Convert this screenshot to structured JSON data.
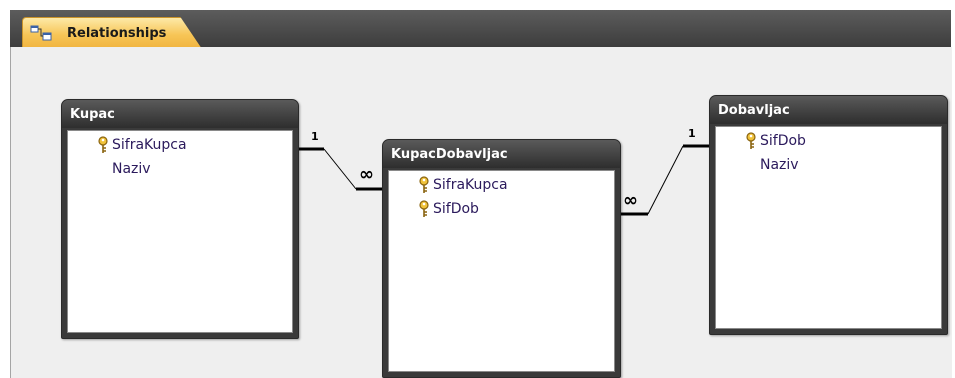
{
  "tab": {
    "label": "Relationships",
    "icon": "relationships-icon"
  },
  "tables": {
    "kupac": {
      "title": "Kupac",
      "fields": [
        "SifraKupca",
        "Naziv"
      ]
    },
    "kupacdobavljac": {
      "title": "KupacDobavljac",
      "fields": [
        "SifraKupca",
        "SifDob"
      ]
    },
    "dobavljac": {
      "title": "Dobavljac",
      "fields": [
        "SifDob",
        "Naziv"
      ]
    }
  },
  "relationships": {
    "kupac_to_kupacdobavljac": {
      "one": "1",
      "many": "∞"
    },
    "dobavljac_to_kupacdobavljac": {
      "one": "1",
      "many": "∞"
    }
  },
  "colors": {
    "tab_bg": "#f7c556",
    "tabbar_bg": "#4a4a4a",
    "canvas_bg": "#efefef",
    "table_title_bg": "#3a3a3a",
    "field_text": "#2b1a5c",
    "key_icon": "#d6a21e"
  }
}
